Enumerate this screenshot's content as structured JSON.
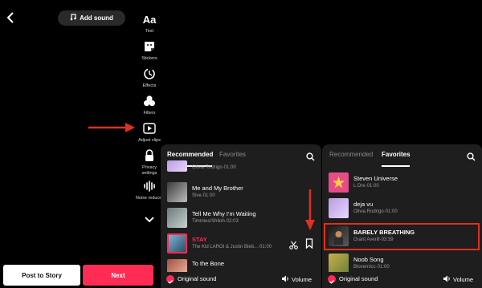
{
  "editor": {
    "add_sound_label": "Add sound",
    "tools": [
      {
        "label": "Text",
        "icon": "text-icon"
      },
      {
        "label": "Stickers",
        "icon": "sticker-icon"
      },
      {
        "label": "Effects",
        "icon": "effects-icon"
      },
      {
        "label": "Filters",
        "icon": "filters-icon"
      },
      {
        "label": "Adjust clips",
        "icon": "adjust-clips-icon"
      },
      {
        "label": "Privacy settings",
        "icon": "lock-icon"
      },
      {
        "label": "Noise reducer",
        "icon": "waveform-icon"
      }
    ],
    "text_glyph": "Aa",
    "post_story_label": "Post to Story",
    "next_label": "Next"
  },
  "panel1": {
    "tabs": [
      "Recommended",
      "Favorites"
    ],
    "active_tab": "Recommended",
    "items": [
      {
        "title": "",
        "subtitle": "Olivia Rodrigo·01:00"
      },
      {
        "title": "Me and My Brother",
        "subtitle": "Sive·01:00"
      },
      {
        "title": "Tell Me Why I'm Waiting",
        "subtitle": "Timmies/Shiloh·02:03"
      },
      {
        "title": "STAY",
        "subtitle": "The Kid LAROI & Justin Bieb...·01:00",
        "selected": true
      },
      {
        "title": "To the Bone",
        "subtitle": ""
      }
    ],
    "original_sound_label": "Original sound",
    "volume_label": "Volume"
  },
  "panel2": {
    "tabs": [
      "Recommended",
      "Favorites"
    ],
    "active_tab": "Favorites",
    "items": [
      {
        "title": "Steven Universe",
        "subtitle": "L.Dre·01:00"
      },
      {
        "title": "deja vu",
        "subtitle": "Olivia Rodrigo·01:00"
      },
      {
        "title": "BARELY BREATHING",
        "subtitle": "Grant Averill·03:39",
        "highlighted": true
      },
      {
        "title": "Noob Song",
        "subtitle": "Bloxernicc·01:00"
      }
    ],
    "original_sound_label": "Original sound",
    "volume_label": "Volume"
  },
  "colors": {
    "accent": "#fe2c55",
    "annotation": "#e0301e",
    "panel_bg": "#1e1e1e"
  }
}
